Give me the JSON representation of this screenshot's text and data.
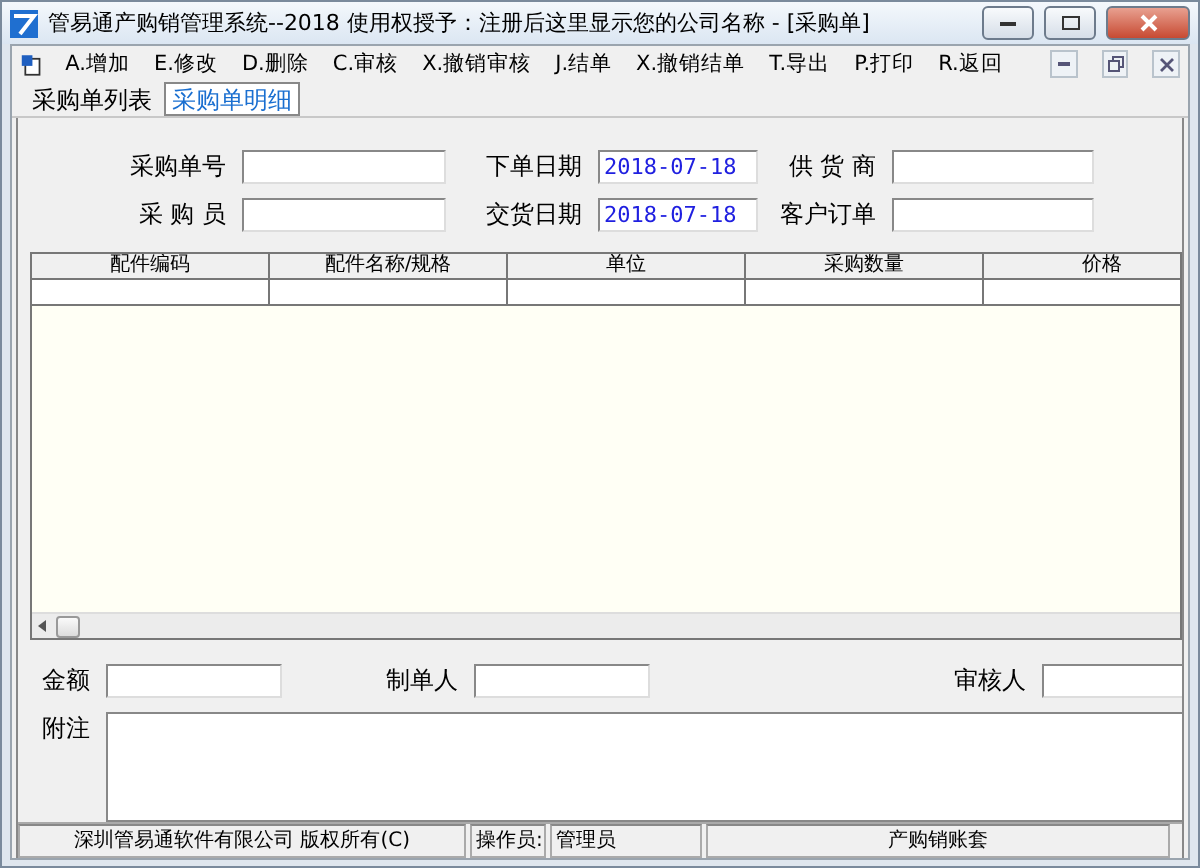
{
  "window": {
    "title": "管易通产购销管理系统--2018 使用权授予：注册后这里显示您的公司名称 - [采购单]"
  },
  "menu": [
    {
      "label": "A.增加"
    },
    {
      "label": "E.修改"
    },
    {
      "label": "D.删除"
    },
    {
      "label": "C.审核"
    },
    {
      "label": "X.撤销审核"
    },
    {
      "label": "J.结单"
    },
    {
      "label": "X.撤销结单"
    },
    {
      "label": "T.导出"
    },
    {
      "label": "P.打印"
    },
    {
      "label": "R.返回"
    }
  ],
  "tabs": [
    {
      "label": "采购单列表",
      "selected": false
    },
    {
      "label": "采购单明细",
      "selected": true
    }
  ],
  "header_fields": [
    {
      "label": "采购单号"
    },
    {
      "label": "下单日期",
      "value": "2018-07-18"
    },
    {
      "label": "供 货 商"
    },
    {
      "label": "采 购 员"
    },
    {
      "label": "交货日期",
      "value": "2018-07-18"
    },
    {
      "label": "客户订单"
    }
  ],
  "table": {
    "columns": [
      "配件编码",
      "配件名称/规格",
      "单位",
      "采购数量",
      "价格"
    ]
  },
  "footer_fields": [
    {
      "label": "金额"
    },
    {
      "label": "制单人"
    },
    {
      "label": "审核人"
    }
  ],
  "note": {
    "label": "附注"
  },
  "status_bar": [
    "深圳管易通软件有限公司 版权所有(C)",
    "操作员:",
    "管理员",
    "产购销账套"
  ]
}
